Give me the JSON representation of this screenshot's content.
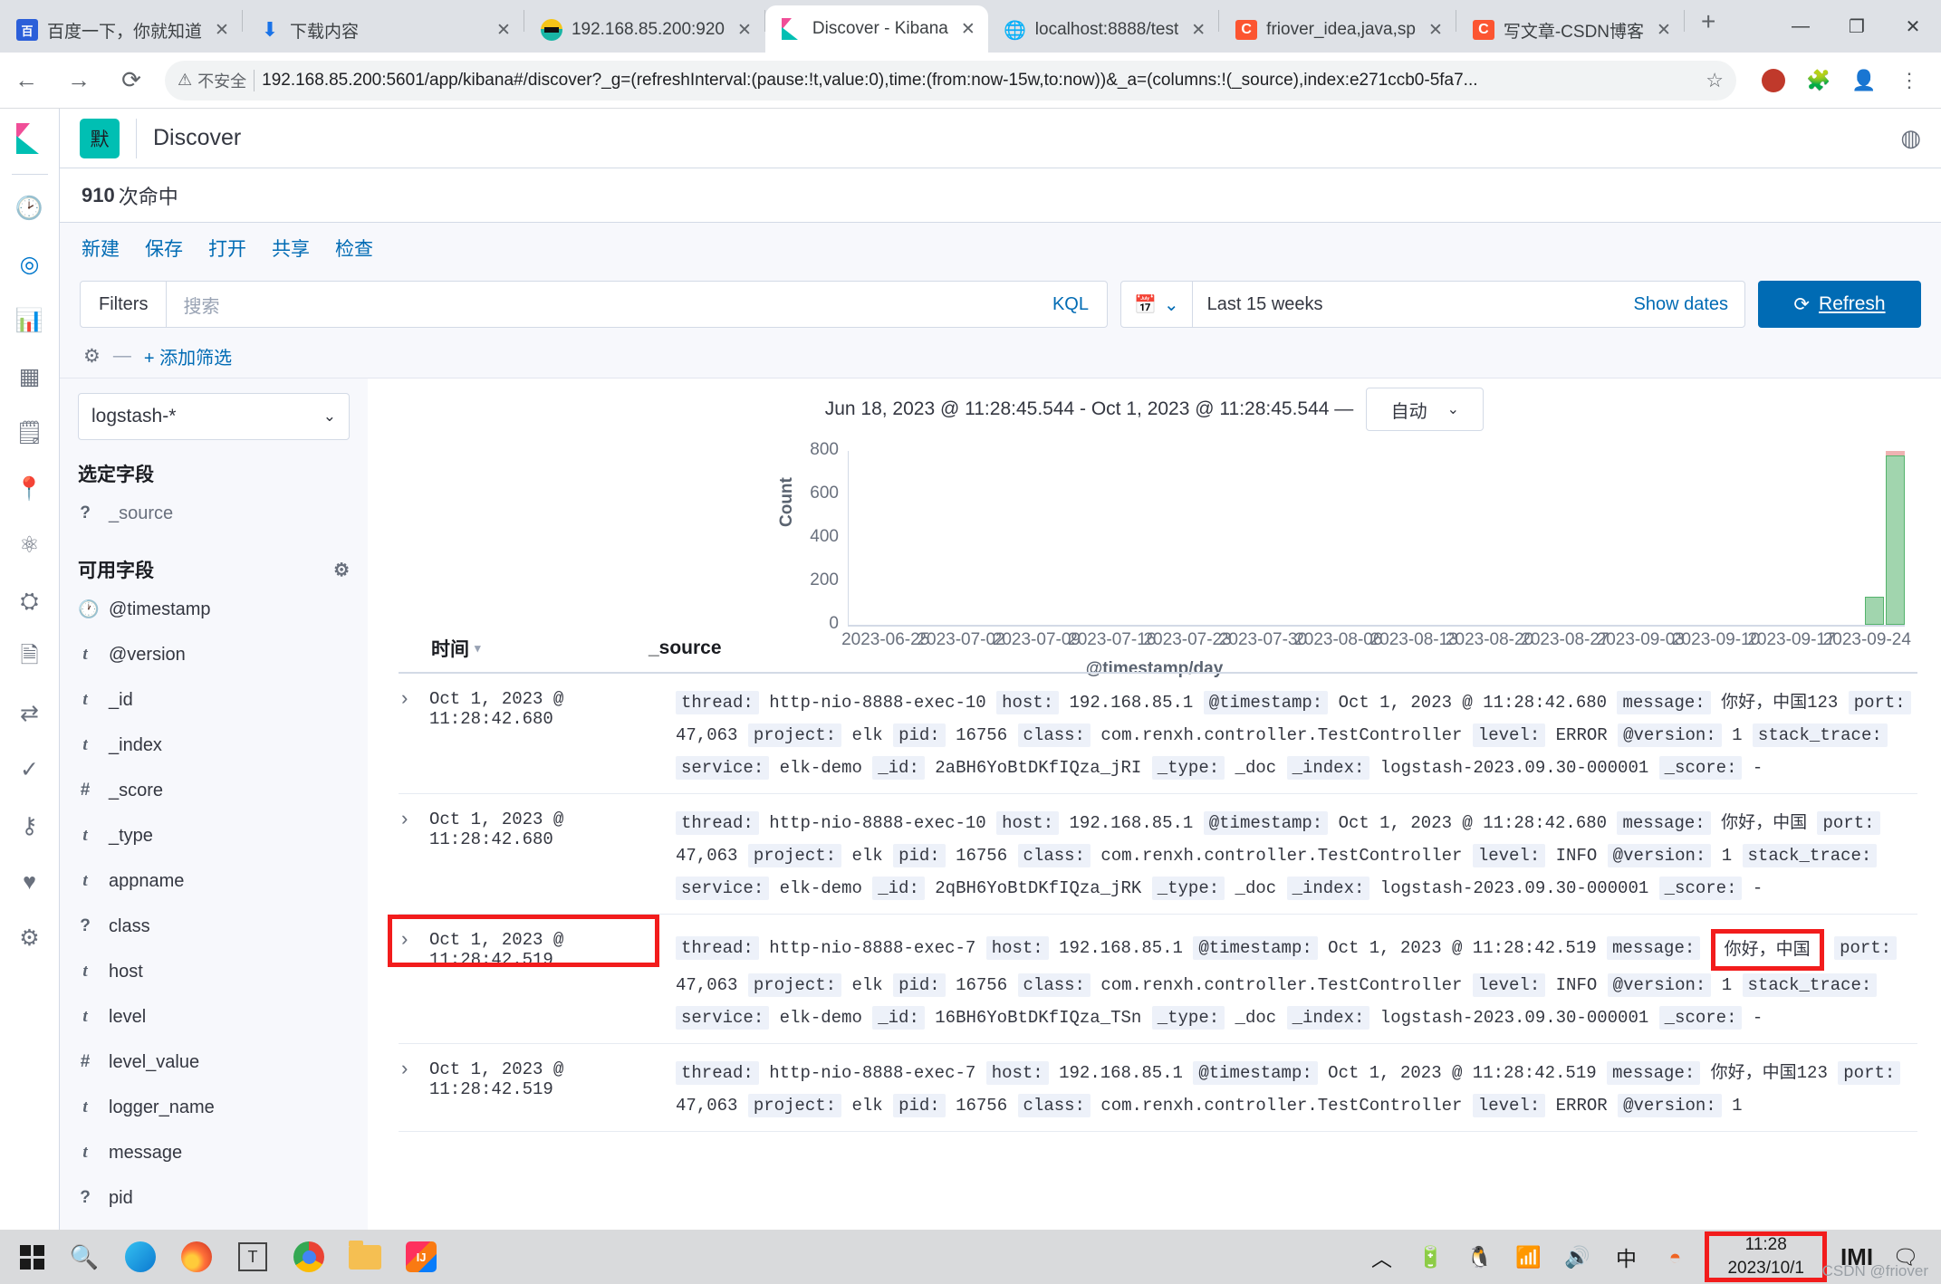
{
  "browser": {
    "tabs": [
      {
        "title": "百度一下，你就知道",
        "icon": "baidu-icon",
        "active": false
      },
      {
        "title": "下载内容",
        "icon": "download-icon",
        "active": false
      },
      {
        "title": "192.168.85.200:920",
        "icon": "minio-icon",
        "active": false
      },
      {
        "title": "Discover - Kibana",
        "icon": "kibana-icon",
        "active": true
      },
      {
        "title": "localhost:8888/test",
        "icon": "globe-icon",
        "active": false
      },
      {
        "title": "friover_idea,java,sp",
        "icon": "csdn-icon",
        "active": false
      },
      {
        "title": "写文章-CSDN博客",
        "icon": "csdn-icon",
        "active": false
      }
    ],
    "new_tab_label": "+",
    "close_glyph": "✕",
    "window_controls": {
      "minimize": "—",
      "maximize": "❐",
      "close": "✕"
    },
    "nav": {
      "back": "←",
      "forward": "→",
      "reload": "⟳"
    },
    "security_label": "不安全",
    "url": "192.168.85.200:5601/app/kibana#/discover?_g=(refreshInterval:(pause:!t,value:0),time:(from:now-15w,to:now))&_a=(columns:!(_source),index:e271ccb0-5fa7...",
    "toolbar_icons": [
      "bookmark-star-icon",
      "extension-red-icon",
      "extensions-puzzle-icon",
      "profile-icon",
      "menu-dots-icon"
    ]
  },
  "kibana": {
    "nav_icons": [
      "recent-clock-icon",
      "discover-compass-icon",
      "visualize-chart-icon",
      "dashboard-grid-icon",
      "canvas-icon",
      "maps-icon",
      "machine-learning-icon",
      "infrastructure-icon",
      "logs-icon",
      "apm-icon",
      "uptime-icon",
      "siem-icon",
      "dev-tools-icon",
      "management-gear-icon"
    ],
    "space_badge": "默",
    "app_title": "Discover",
    "header_right_icon": "help-icon",
    "hits_count": "910",
    "hits_suffix": "次命中",
    "menu": [
      {
        "label": "新建",
        "name": "new"
      },
      {
        "label": "保存",
        "name": "save"
      },
      {
        "label": "打开",
        "name": "open"
      },
      {
        "label": "共享",
        "name": "share"
      },
      {
        "label": "检查",
        "name": "inspect"
      }
    ],
    "query_bar": {
      "filters_label": "Filters",
      "search_placeholder": "搜索",
      "language_label": "KQL",
      "calendar_icon": "calendar-icon",
      "date_range": "Last 15 weeks",
      "show_dates_label": "Show dates",
      "refresh_label": "Refresh",
      "refresh_icon": "refresh-icon"
    },
    "filter_row": {
      "gear_icon": "filter-options-gear-icon",
      "dash": "—",
      "add_filter_label": "+ 添加筛选"
    },
    "sidebar": {
      "index_pattern": "logstash-*",
      "selected_title": "选定字段",
      "selected_fields": [
        {
          "type": "?",
          "name": "_source"
        }
      ],
      "available_title": "可用字段",
      "available_gear_icon": "field-settings-gear-icon",
      "available_fields": [
        {
          "type": "clock",
          "name": "@timestamp"
        },
        {
          "type": "t",
          "name": "@version"
        },
        {
          "type": "t",
          "name": "_id"
        },
        {
          "type": "t",
          "name": "_index"
        },
        {
          "type": "#",
          "name": "_score"
        },
        {
          "type": "t",
          "name": "_type"
        },
        {
          "type": "t",
          "name": "appname"
        },
        {
          "type": "?",
          "name": "class"
        },
        {
          "type": "t",
          "name": "host"
        },
        {
          "type": "t",
          "name": "level"
        },
        {
          "type": "#",
          "name": "level_value"
        },
        {
          "type": "t",
          "name": "logger_name"
        },
        {
          "type": "t",
          "name": "message"
        },
        {
          "type": "?",
          "name": "pid"
        }
      ]
    },
    "collapse_icon": "collapse-left-icon",
    "chart_header": {
      "range_text": "Jun 18, 2023 @ 11:28:45.544 - Oct 1, 2023 @ 11:28:45.544 —",
      "interval_label": "自动",
      "interval_chevron": "⌄"
    },
    "table": {
      "col_time": "时间",
      "col_time_sort_icon": "sort-desc-icon",
      "col_source": "_source",
      "expand_icon": "›",
      "rows": [
        {
          "time": "Oct 1, 2023 @ 11:28:42.680",
          "time_highlighted": false,
          "fields": [
            {
              "key": "thread:",
              "val": "http-nio-8888-exec-10"
            },
            {
              "key": "host:",
              "val": "192.168.85.1"
            },
            {
              "key": "@timestamp:",
              "val": "Oct 1, 2023 @ 11:28:42.680"
            },
            {
              "key": "message:",
              "val": "你好，中国123"
            },
            {
              "key": "port:",
              "val": "47,063"
            },
            {
              "key": "project:",
              "val": "elk"
            },
            {
              "key": "pid:",
              "val": "16756"
            },
            {
              "key": "class:",
              "val": "com.renxh.controller.TestController"
            },
            {
              "key": "level:",
              "val": "ERROR"
            },
            {
              "key": "@version:",
              "val": "1"
            },
            {
              "key": "stack_trace:",
              "val": ""
            },
            {
              "key": "service:",
              "val": "elk-demo"
            },
            {
              "key": "_id:",
              "val": "2aBH6YoBtDKfIQza_jRI"
            },
            {
              "key": "_type:",
              "val": "_doc"
            },
            {
              "key": "_index:",
              "val": "logstash-2023.09.30-000001"
            },
            {
              "key": "_score:",
              "val": "-"
            }
          ]
        },
        {
          "time": "Oct 1, 2023 @ 11:28:42.680",
          "time_highlighted": false,
          "fields": [
            {
              "key": "thread:",
              "val": "http-nio-8888-exec-10"
            },
            {
              "key": "host:",
              "val": "192.168.85.1"
            },
            {
              "key": "@timestamp:",
              "val": "Oct 1, 2023 @ 11:28:42.680"
            },
            {
              "key": "message:",
              "val": "你好，中国"
            },
            {
              "key": "port:",
              "val": "47,063"
            },
            {
              "key": "project:",
              "val": "elk"
            },
            {
              "key": "pid:",
              "val": "16756"
            },
            {
              "key": "class:",
              "val": "com.renxh.controller.TestController"
            },
            {
              "key": "level:",
              "val": "INFO"
            },
            {
              "key": "@version:",
              "val": "1"
            },
            {
              "key": "stack_trace:",
              "val": ""
            },
            {
              "key": "service:",
              "val": "elk-demo"
            },
            {
              "key": "_id:",
              "val": "2qBH6YoBtDKfIQza_jRK"
            },
            {
              "key": "_type:",
              "val": "_doc"
            },
            {
              "key": "_index:",
              "val": "logstash-2023.09.30-000001"
            },
            {
              "key": "_score:",
              "val": "-"
            }
          ]
        },
        {
          "time": "Oct 1, 2023 @ 11:28:42.519",
          "time_highlighted": true,
          "fields": [
            {
              "key": "thread:",
              "val": "http-nio-8888-exec-7"
            },
            {
              "key": "host:",
              "val": "192.168.85.1"
            },
            {
              "key": "@timestamp:",
              "val": "Oct 1, 2023 @ 11:28:42.519"
            },
            {
              "key": "message:",
              "val": "你好，中国",
              "highlighted": true
            },
            {
              "key": "port:",
              "val": "47,063"
            },
            {
              "key": "project:",
              "val": "elk"
            },
            {
              "key": "pid:",
              "val": "16756"
            },
            {
              "key": "class:",
              "val": "com.renxh.controller.TestController"
            },
            {
              "key": "level:",
              "val": "INFO"
            },
            {
              "key": "@version:",
              "val": "1"
            },
            {
              "key": "stack_trace:",
              "val": ""
            },
            {
              "key": "service:",
              "val": "elk-demo"
            },
            {
              "key": "_id:",
              "val": "16BH6YoBtDKfIQza_TSn"
            },
            {
              "key": "_type:",
              "val": "_doc"
            },
            {
              "key": "_index:",
              "val": "logstash-2023.09.30-000001"
            },
            {
              "key": "_score:",
              "val": "-"
            }
          ]
        },
        {
          "time": "Oct 1, 2023 @ 11:28:42.519",
          "time_highlighted": false,
          "fields": [
            {
              "key": "thread:",
              "val": "http-nio-8888-exec-7"
            },
            {
              "key": "host:",
              "val": "192.168.85.1"
            },
            {
              "key": "@timestamp:",
              "val": "Oct 1, 2023 @ 11:28:42.519"
            },
            {
              "key": "message:",
              "val": "你好，中国123"
            },
            {
              "key": "port:",
              "val": "47,063"
            },
            {
              "key": "project:",
              "val": "elk"
            },
            {
              "key": "pid:",
              "val": "16756"
            },
            {
              "key": "class:",
              "val": "com.renxh.controller.TestController"
            },
            {
              "key": "level:",
              "val": "ERROR"
            },
            {
              "key": "@version:",
              "val": "1"
            }
          ]
        }
      ]
    }
  },
  "taskbar": {
    "items": [
      {
        "name": "start-button",
        "icon": "windows-logo-icon"
      },
      {
        "name": "search-button",
        "icon": "search-icon"
      },
      {
        "name": "edge-button",
        "icon": "edge-icon"
      },
      {
        "name": "firefox-button",
        "icon": "firefox-icon"
      },
      {
        "name": "typora-button",
        "icon": "typora-icon"
      },
      {
        "name": "chrome-button",
        "icon": "chrome-icon"
      },
      {
        "name": "explorer-button",
        "icon": "file-explorer-icon"
      },
      {
        "name": "intellij-button",
        "icon": "intellij-idea-icon"
      }
    ],
    "tray": [
      {
        "name": "show-hidden-icons",
        "icon": "chevron-up-icon",
        "glyph": "︿"
      },
      {
        "name": "battery-icon",
        "icon": "battery-icon",
        "glyph": "🔌"
      },
      {
        "name": "qq-icon",
        "icon": "qq-penguin-icon",
        "glyph": "🐧"
      },
      {
        "name": "network-icon",
        "icon": "wifi-icon",
        "glyph": "📶"
      },
      {
        "name": "volume-icon",
        "icon": "speaker-icon",
        "glyph": "🔊"
      },
      {
        "name": "ime-icon",
        "icon": "ime-chinese-icon",
        "glyph": "中"
      },
      {
        "name": "app-icon",
        "icon": "orange-app-icon",
        "glyph": "◓"
      }
    ],
    "clock": {
      "time": "11:28",
      "date": "2023/10/1"
    },
    "watermark": "CSDN @friover",
    "watermark_logo": "IMI",
    "notification_icon": "notification-icon"
  },
  "chart_data": {
    "type": "bar",
    "title": "",
    "xlabel": "@timestamp/day",
    "ylabel": "Count",
    "ylim": [
      0,
      800
    ],
    "yticks": [
      0,
      200,
      400,
      600,
      800
    ],
    "categories": [
      "2023-06-25",
      "2023-07-02",
      "2023-07-09",
      "2023-07-16",
      "2023-07-23",
      "2023-07-30",
      "2023-08-06",
      "2023-08-13",
      "2023-08-20",
      "2023-08-27",
      "2023-09-03",
      "2023-09-10",
      "2023-09-17",
      "2023-09-24"
    ],
    "grid": false,
    "legend": false,
    "bars": [
      {
        "x_frac": 0.962,
        "value": 130,
        "width_frac": 0.018,
        "color": "#54b36c"
      },
      {
        "x_frac": 0.982,
        "value": 780,
        "width_frac": 0.018,
        "color": "#54b36c",
        "cap_value": 800,
        "cap_color": "#e27373"
      }
    ],
    "note": "Data concentrated at the far right of the time range (late Sept / Oct 1, 2023); all earlier days are zero."
  }
}
